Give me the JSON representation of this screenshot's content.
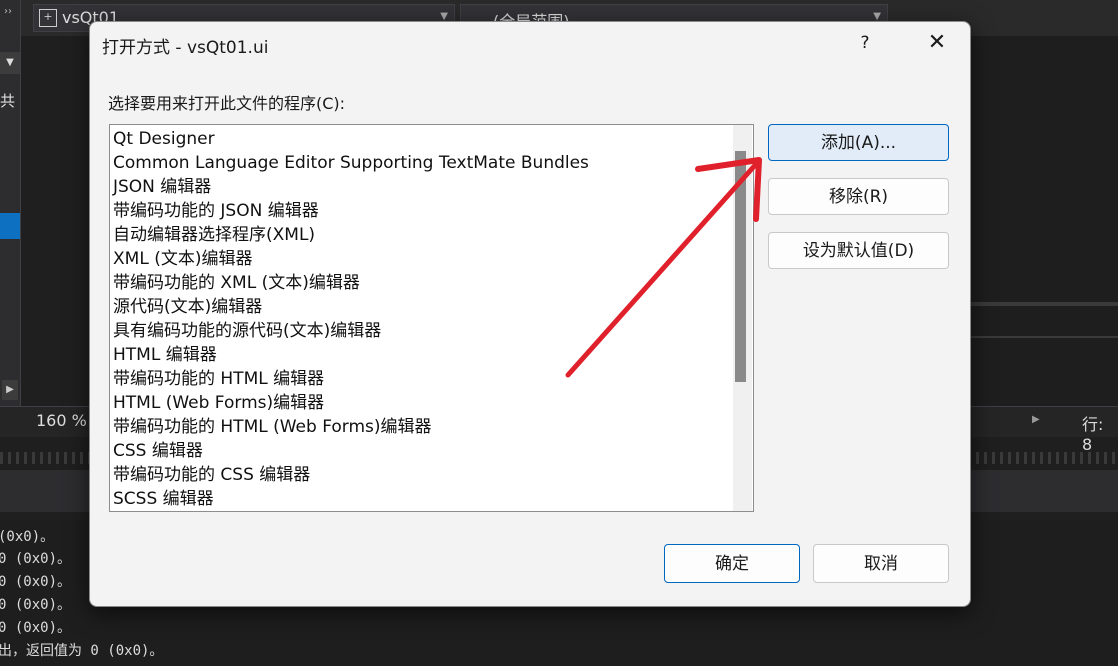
{
  "ide": {
    "file_name": "vsQt01",
    "scope": "(全局范围)",
    "left_char": "共",
    "zoom": "160 %",
    "line": "行: 8",
    "output_lines": [
      "(0x0)。",
      "0 (0x0)。",
      "0 (0x0)。",
      "0 (0x0)。",
      "0 (0x0)。",
      "出，返回值为 0 (0x0)。"
    ]
  },
  "dialog": {
    "title": "打开方式 - vsQt01.ui",
    "help": "?",
    "close": "✕",
    "prompt": "选择要用来打开此文件的程序(C):",
    "programs": [
      "Qt Designer",
      "Common Language Editor Supporting TextMate Bundles",
      "JSON 编辑器",
      "带编码功能的 JSON 编辑器",
      "自动编辑器选择程序(XML)",
      "XML (文本)编辑器",
      "带编码功能的 XML (文本)编辑器",
      "源代码(文本)编辑器",
      "具有编码功能的源代码(文本)编辑器",
      "HTML 编辑器",
      "带编码功能的 HTML 编辑器",
      "HTML (Web Forms)编辑器",
      "带编码功能的 HTML (Web Forms)编辑器",
      "CSS 编辑器",
      "带编码功能的 CSS 编辑器",
      "SCSS 编辑器"
    ],
    "buttons": {
      "add": "添加(A)...",
      "remove": "移除(R)",
      "set_default": "设为默认值(D)",
      "ok": "确定",
      "cancel": "取消"
    }
  },
  "colors": {
    "annotation_arrow": "#e0212b",
    "focus_border": "#0067c0",
    "ide_background": "#1f1f1f"
  }
}
